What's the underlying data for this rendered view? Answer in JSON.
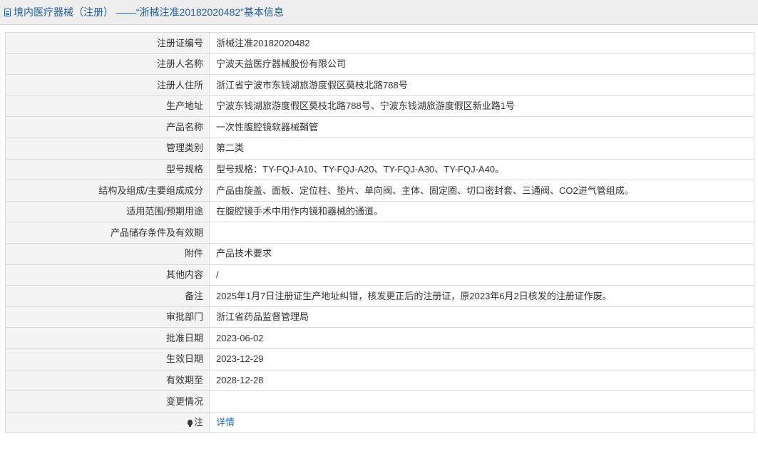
{
  "header": {
    "title": "境内医疗器械（注册） ——“浙械注准20182020482”基本信息",
    "icon": "document-icon"
  },
  "rows": [
    {
      "label": "注册证编号",
      "value": "浙械注准20182020482"
    },
    {
      "label": "注册人名称",
      "value": "宁波天益医疗器械股份有限公司"
    },
    {
      "label": "注册人住所",
      "value": "浙江省宁波市东钱湖旅游度假区莫枝北路788号"
    },
    {
      "label": "生产地址",
      "value": "宁波东钱湖旅游度假区莫枝北路788号、宁波东钱湖旅游度假区新业路1号"
    },
    {
      "label": "产品名称",
      "value": "一次性腹腔镜软器械鞘管"
    },
    {
      "label": "管理类别",
      "value": "第二类"
    },
    {
      "label": "型号规格",
      "value": "型号规格：TY-FQJ-A10、TY-FQJ-A20、TY-FQJ-A30、TY-FQJ-A40。"
    },
    {
      "label": "结构及组成/主要组成成分",
      "value": "产品由旋盖、面板、定位柱、垫片、单向阀、主体、固定圈、切口密封套、三通阀、CO2进气管组成。"
    },
    {
      "label": "适用范围/预期用途",
      "value": "在腹腔镜手术中用作内镜和器械的通道。"
    },
    {
      "label": "产品储存条件及有效期",
      "value": ""
    },
    {
      "label": "附件",
      "value": "产品技术要求"
    },
    {
      "label": "其他内容",
      "value": "/"
    },
    {
      "label": "备注",
      "value": "2025年1月7日注册证生产地址纠错，核发更正后的注册证，原2023年6月2日核发的注册证作废。"
    },
    {
      "label": "审批部门",
      "value": "浙江省药品监督管理局"
    },
    {
      "label": "批准日期",
      "value": "2023-06-02"
    },
    {
      "label": "生效日期",
      "value": "2023-12-29"
    },
    {
      "label": "有效期至",
      "value": "2028-12-28"
    },
    {
      "label": "变更情况",
      "value": ""
    }
  ],
  "note": {
    "label": "注",
    "icon": "lightbulb-icon",
    "link": "详情"
  },
  "colors": {
    "title_text": "#1f5f9e",
    "link": "#1f6fc5",
    "label_bg": "#f4f4f4",
    "border": "#dcdcdc",
    "titlebar_bg": "#eeeeee"
  }
}
